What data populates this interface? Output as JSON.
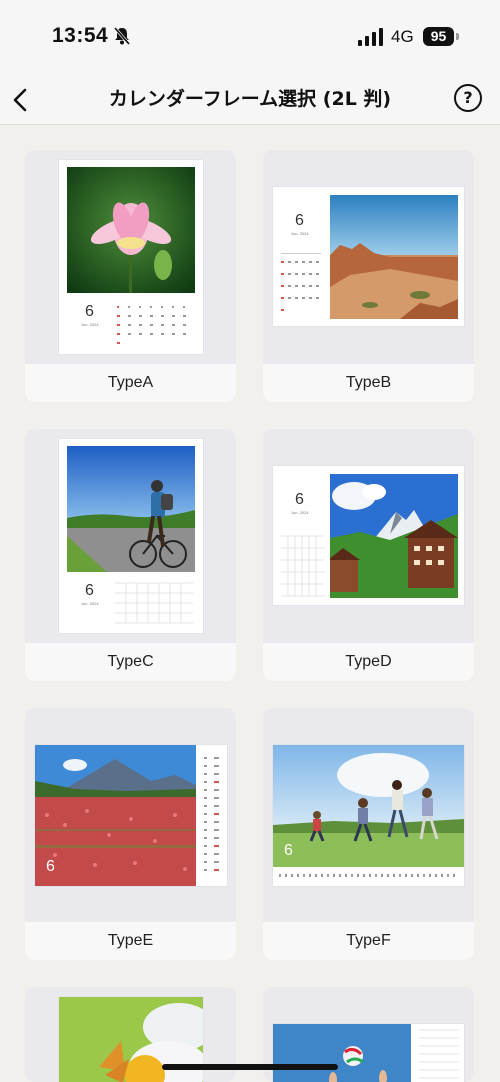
{
  "status_bar": {
    "time": "13:54",
    "network": "4G",
    "battery": "95"
  },
  "nav": {
    "title": "カレンダーフレーム選択 (2L 判)",
    "help_glyph": "?"
  },
  "calendar": {
    "month_number": "6",
    "month_caption": "Jun. 2024"
  },
  "types": [
    {
      "label": "TypeA"
    },
    {
      "label": "TypeB"
    },
    {
      "label": "TypeC"
    },
    {
      "label": "TypeD"
    },
    {
      "label": "TypeE"
    },
    {
      "label": "TypeF"
    }
  ],
  "icons": [
    "back-chevron-icon",
    "bell-off-icon",
    "signal-icon",
    "battery-icon",
    "help-icon"
  ],
  "colors": {
    "background": "#f1f0ec",
    "card": "#e9e9ee",
    "label_bar": "#f8f8f8",
    "sunday_red": "#d9534f"
  }
}
